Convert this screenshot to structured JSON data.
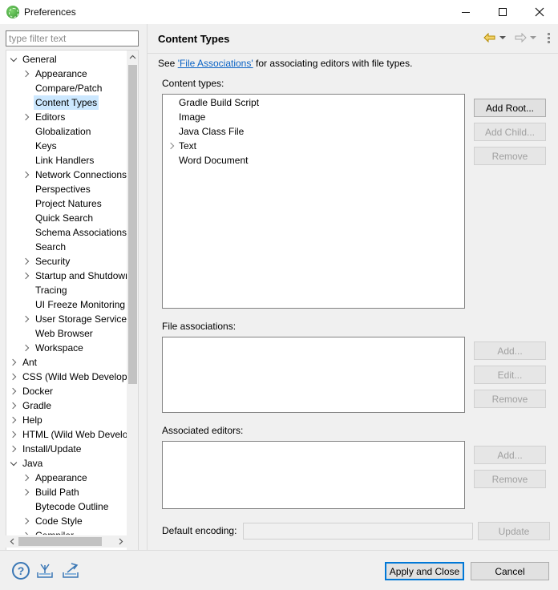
{
  "window": {
    "title": "Preferences"
  },
  "left": {
    "filter_placeholder": "type filter text",
    "tree": [
      {
        "label": "General",
        "level": 0,
        "state": "open"
      },
      {
        "label": "Appearance",
        "level": 1,
        "state": "closed"
      },
      {
        "label": "Compare/Patch",
        "level": 1,
        "state": "leaf"
      },
      {
        "label": "Content Types",
        "level": 1,
        "state": "leaf",
        "selected": true
      },
      {
        "label": "Editors",
        "level": 1,
        "state": "closed"
      },
      {
        "label": "Globalization",
        "level": 1,
        "state": "leaf"
      },
      {
        "label": "Keys",
        "level": 1,
        "state": "leaf"
      },
      {
        "label": "Link Handlers",
        "level": 1,
        "state": "leaf"
      },
      {
        "label": "Network Connections",
        "level": 1,
        "state": "closed"
      },
      {
        "label": "Perspectives",
        "level": 1,
        "state": "leaf"
      },
      {
        "label": "Project Natures",
        "level": 1,
        "state": "leaf"
      },
      {
        "label": "Quick Search",
        "level": 1,
        "state": "leaf"
      },
      {
        "label": "Schema Associations",
        "level": 1,
        "state": "leaf"
      },
      {
        "label": "Search",
        "level": 1,
        "state": "leaf"
      },
      {
        "label": "Security",
        "level": 1,
        "state": "closed"
      },
      {
        "label": "Startup and Shutdown",
        "level": 1,
        "state": "closed"
      },
      {
        "label": "Tracing",
        "level": 1,
        "state": "leaf"
      },
      {
        "label": "UI Freeze Monitoring",
        "level": 1,
        "state": "leaf"
      },
      {
        "label": "User Storage Service",
        "level": 1,
        "state": "closed"
      },
      {
        "label": "Web Browser",
        "level": 1,
        "state": "leaf"
      },
      {
        "label": "Workspace",
        "level": 1,
        "state": "closed"
      },
      {
        "label": "Ant",
        "level": 0,
        "state": "closed"
      },
      {
        "label": "CSS (Wild Web Developer)",
        "level": 0,
        "state": "closed"
      },
      {
        "label": "Docker",
        "level": 0,
        "state": "closed"
      },
      {
        "label": "Gradle",
        "level": 0,
        "state": "closed"
      },
      {
        "label": "Help",
        "level": 0,
        "state": "closed"
      },
      {
        "label": "HTML (Wild Web Developer)",
        "level": 0,
        "state": "closed"
      },
      {
        "label": "Install/Update",
        "level": 0,
        "state": "closed"
      },
      {
        "label": "Java",
        "level": 0,
        "state": "open"
      },
      {
        "label": "Appearance",
        "level": 1,
        "state": "closed"
      },
      {
        "label": "Build Path",
        "level": 1,
        "state": "closed"
      },
      {
        "label": "Bytecode Outline",
        "level": 1,
        "state": "leaf"
      },
      {
        "label": "Code Style",
        "level": 1,
        "state": "closed"
      },
      {
        "label": "Compiler",
        "level": 1,
        "state": "closed"
      }
    ]
  },
  "page": {
    "title": "Content Types",
    "desc_prefix": "See ",
    "desc_link": "'File Associations'",
    "desc_suffix": " for associating editors with file types.",
    "content_types_label": "Content types:",
    "content_types": [
      {
        "label": "Gradle Build Script",
        "expandable": false
      },
      {
        "label": "Image",
        "expandable": false
      },
      {
        "label": "Java Class File",
        "expandable": false
      },
      {
        "label": "Text",
        "expandable": true
      },
      {
        "label": "Word Document",
        "expandable": false
      }
    ],
    "buttons_ct": {
      "add_root": "Add Root...",
      "add_child": "Add Child...",
      "remove": "Remove"
    },
    "file_assoc_label": "File associations:",
    "buttons_fa": {
      "add": "Add...",
      "edit": "Edit...",
      "remove": "Remove"
    },
    "assoc_editors_label": "Associated editors:",
    "buttons_ae": {
      "add": "Add...",
      "remove": "Remove"
    },
    "encoding_label": "Default encoding:",
    "encoding_value": "",
    "update_label": "Update"
  },
  "bottom": {
    "apply_close": "Apply and Close",
    "cancel": "Cancel"
  },
  "icons": {
    "back": "back-arrow-icon",
    "forward": "forward-arrow-icon",
    "menu": "view-menu-icon",
    "help": "help-icon",
    "import": "import-icon",
    "export": "export-icon"
  }
}
